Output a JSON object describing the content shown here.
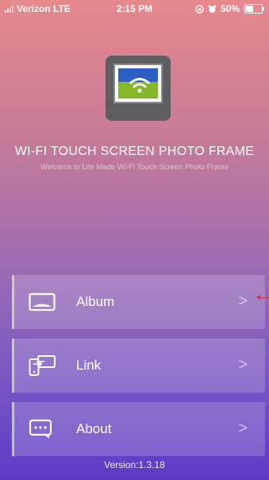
{
  "status_bar": {
    "carrier": "Verizon LTE",
    "time": "2:15 PM",
    "battery": "50%",
    "battery_level": 0.5
  },
  "app": {
    "title": "WI-FI TOUCH SCREEN PHOTO FRAME",
    "subtitle": "Welcome to Life Made Wi-Fi Touch Screen Photo Frame"
  },
  "menu": [
    {
      "label": "Album",
      "icon": "photo-icon"
    },
    {
      "label": "Link",
      "icon": "link-devices-icon"
    },
    {
      "label": "About",
      "icon": "about-icon"
    }
  ],
  "chevron": ">",
  "version": "Version:1.3.18",
  "colors": {
    "gradient_top": "#e6898d",
    "gradient_bottom": "#5b3bc4",
    "accent_pointer": "#e0302a"
  }
}
